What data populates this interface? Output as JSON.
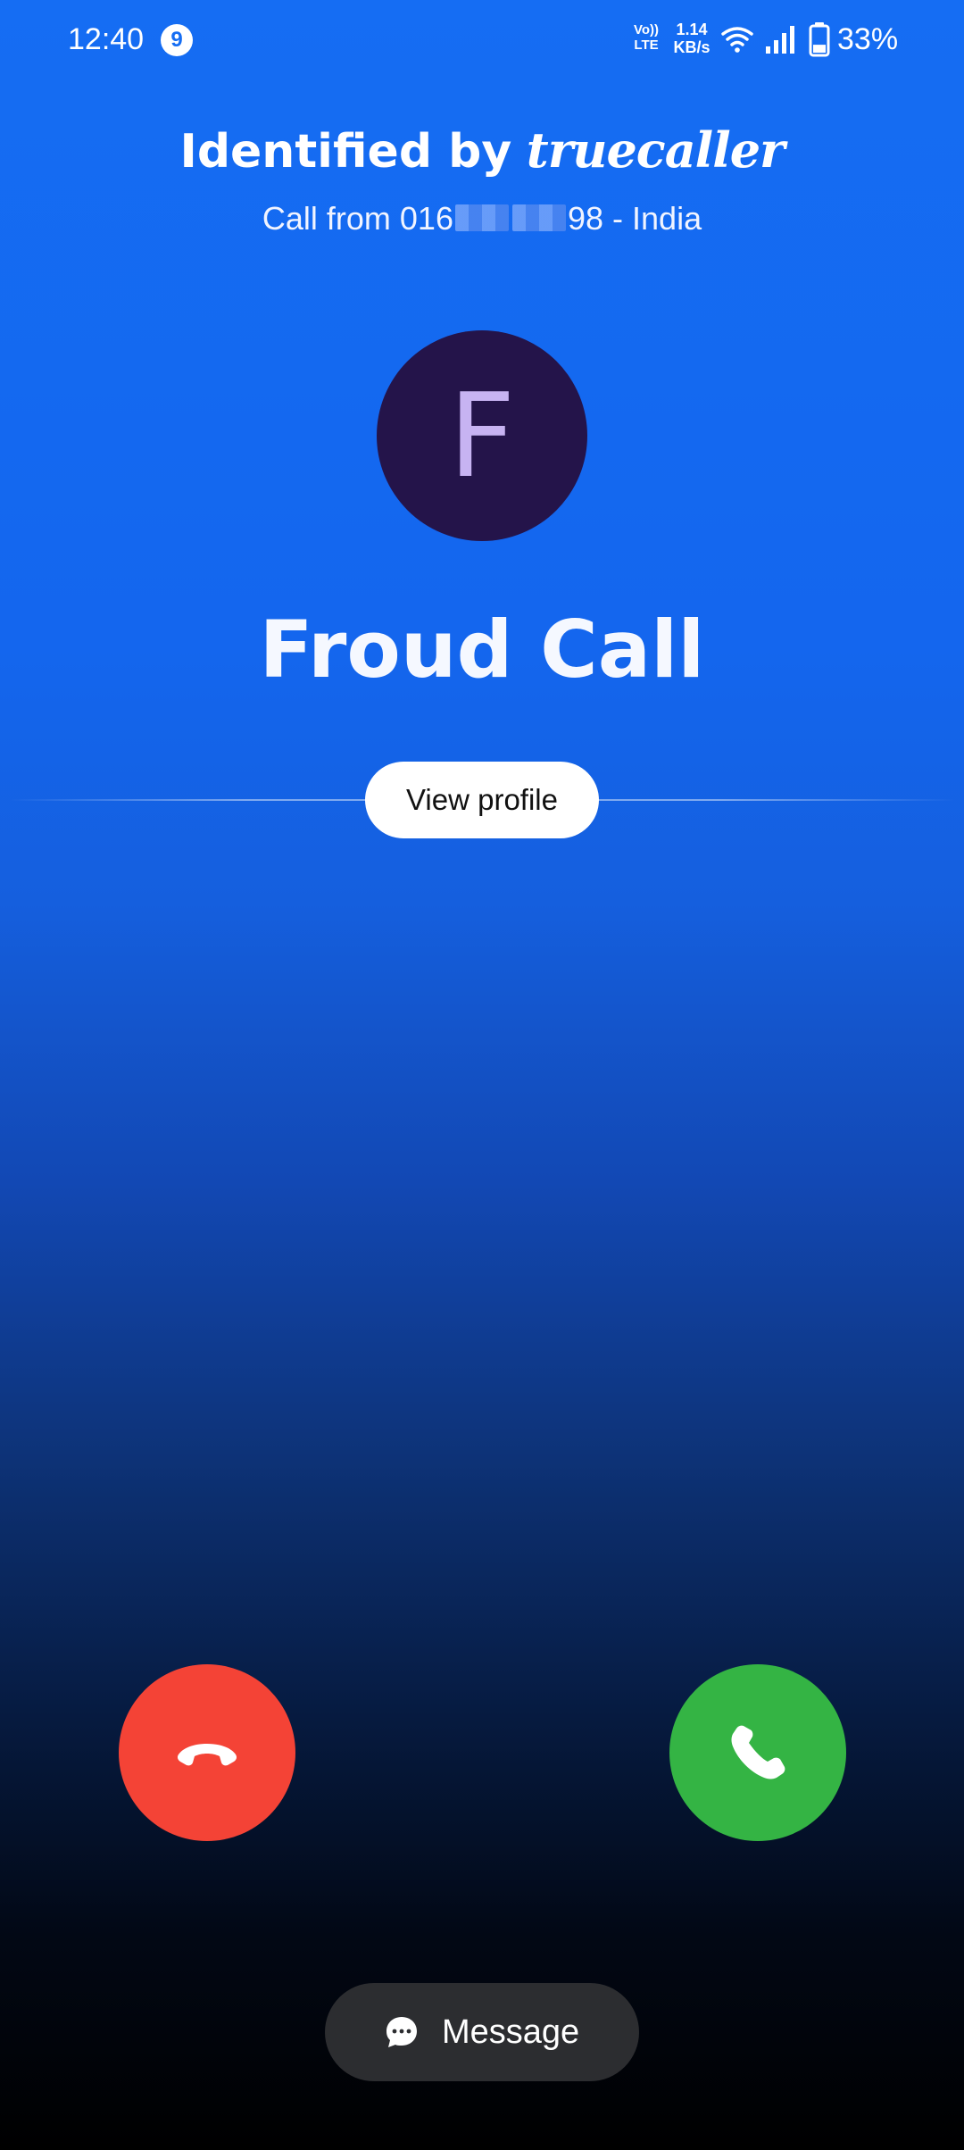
{
  "status_bar": {
    "time": "12:40",
    "notification_count": "9",
    "volte_line1": "Vo))",
    "volte_line2": "LTE",
    "net_speed_value": "1.14",
    "net_speed_unit": "KB/s",
    "battery_percent": "33%",
    "battery_level": 0.33
  },
  "header": {
    "identified_by": "Identified by",
    "brand": "truecaller",
    "call_from_prefix": "Call from 016",
    "call_from_suffix": "98 - India"
  },
  "caller": {
    "avatar_initial": "F",
    "name": "Froud Call"
  },
  "actions": {
    "view_profile_label": "View profile",
    "message_label": "Message"
  },
  "colors": {
    "decline": "#f44336",
    "accept": "#34b444",
    "avatar_bg": "#24144a",
    "avatar_text": "#c7b3f2"
  },
  "icons": {
    "decline": "phone-hangup-icon",
    "accept": "phone-icon",
    "message": "chat-bubble-icon"
  }
}
